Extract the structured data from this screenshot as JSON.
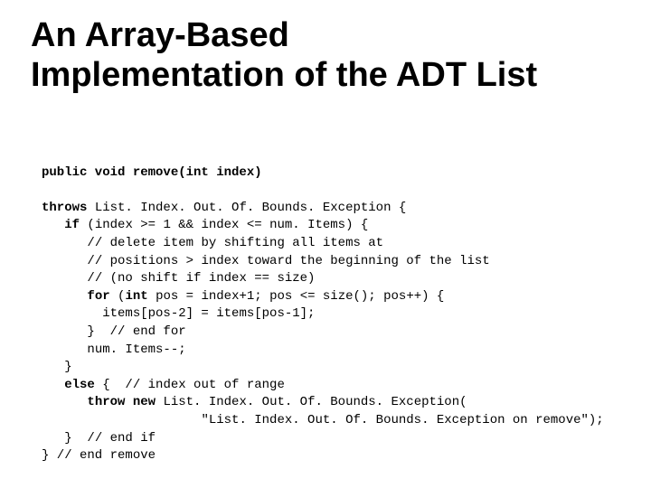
{
  "title_line1": "An Array-Based",
  "title_line2": "Implementation of the ADT List",
  "code": {
    "l01_sig": "public void remove(int index)",
    "l02a": "throws",
    "l02b": " List. Index. Out. Of. Bounds. Exception {",
    "l03a": "if",
    "l03b": " (index >= 1 && index <= num. Items) {",
    "l04": "// delete item by shifting all items at",
    "l05": "// positions > index toward the beginning of the list",
    "l06": "// (no shift if index == size)",
    "l07a": "for",
    "l07b": " (",
    "l07c": "int",
    "l07d": " pos = index+1; pos <= size(); pos++) {",
    "l08": "items[pos-2] = items[pos-1];",
    "l09": "}  // end for",
    "l10": "num. Items--; ",
    "l11": "}",
    "l12a": "else",
    "l12b": " {  // index out of range",
    "l13a": "throw new",
    "l13b": " List. Index. Out. Of. Bounds. Exception(",
    "l14": "\"List. Index. Out. Of. Bounds. Exception on remove\");",
    "l15": "}  // end if",
    "l16": "} // end remove"
  }
}
